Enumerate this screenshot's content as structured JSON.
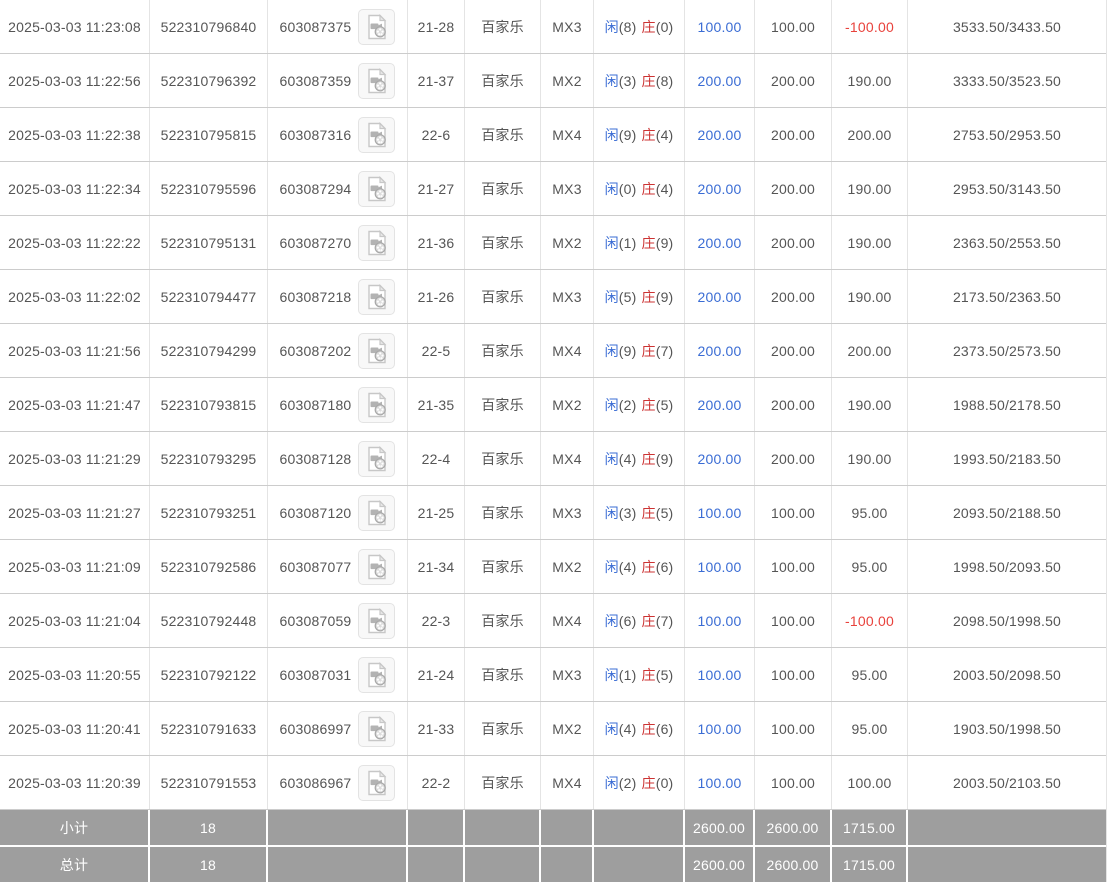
{
  "colors": {
    "text": "#555555",
    "link_blue": "#3a6cd4",
    "banker_red": "#cc3333",
    "negative_red": "#e8423c",
    "footer_bg": "#9e9e9e",
    "row_border": "#cccccc"
  },
  "table": {
    "result_labels": {
      "player": "闲",
      "banker": "庄"
    },
    "rows": [
      {
        "time": "2025-03-03 11:23:08",
        "bet_id": "522310796840",
        "game_id": "603087375",
        "round": "21-28",
        "game": "百家乐",
        "table": "MX3",
        "player": "8",
        "banker": "0",
        "bet": "100.00",
        "valid": "100.00",
        "winloss": "-100.00",
        "balance": "3533.50/3433.50"
      },
      {
        "time": "2025-03-03 11:22:56",
        "bet_id": "522310796392",
        "game_id": "603087359",
        "round": "21-37",
        "game": "百家乐",
        "table": "MX2",
        "player": "3",
        "banker": "8",
        "bet": "200.00",
        "valid": "200.00",
        "winloss": "190.00",
        "balance": "3333.50/3523.50"
      },
      {
        "time": "2025-03-03 11:22:38",
        "bet_id": "522310795815",
        "game_id": "603087316",
        "round": "22-6",
        "game": "百家乐",
        "table": "MX4",
        "player": "9",
        "banker": "4",
        "bet": "200.00",
        "valid": "200.00",
        "winloss": "200.00",
        "balance": "2753.50/2953.50"
      },
      {
        "time": "2025-03-03 11:22:34",
        "bet_id": "522310795596",
        "game_id": "603087294",
        "round": "21-27",
        "game": "百家乐",
        "table": "MX3",
        "player": "0",
        "banker": "4",
        "bet": "200.00",
        "valid": "200.00",
        "winloss": "190.00",
        "balance": "2953.50/3143.50"
      },
      {
        "time": "2025-03-03 11:22:22",
        "bet_id": "522310795131",
        "game_id": "603087270",
        "round": "21-36",
        "game": "百家乐",
        "table": "MX2",
        "player": "1",
        "banker": "9",
        "bet": "200.00",
        "valid": "200.00",
        "winloss": "190.00",
        "balance": "2363.50/2553.50"
      },
      {
        "time": "2025-03-03 11:22:02",
        "bet_id": "522310794477",
        "game_id": "603087218",
        "round": "21-26",
        "game": "百家乐",
        "table": "MX3",
        "player": "5",
        "banker": "9",
        "bet": "200.00",
        "valid": "200.00",
        "winloss": "190.00",
        "balance": "2173.50/2363.50"
      },
      {
        "time": "2025-03-03 11:21:56",
        "bet_id": "522310794299",
        "game_id": "603087202",
        "round": "22-5",
        "game": "百家乐",
        "table": "MX4",
        "player": "9",
        "banker": "7",
        "bet": "200.00",
        "valid": "200.00",
        "winloss": "200.00",
        "balance": "2373.50/2573.50"
      },
      {
        "time": "2025-03-03 11:21:47",
        "bet_id": "522310793815",
        "game_id": "603087180",
        "round": "21-35",
        "game": "百家乐",
        "table": "MX2",
        "player": "2",
        "banker": "5",
        "bet": "200.00",
        "valid": "200.00",
        "winloss": "190.00",
        "balance": "1988.50/2178.50"
      },
      {
        "time": "2025-03-03 11:21:29",
        "bet_id": "522310793295",
        "game_id": "603087128",
        "round": "22-4",
        "game": "百家乐",
        "table": "MX4",
        "player": "4",
        "banker": "9",
        "bet": "200.00",
        "valid": "200.00",
        "winloss": "190.00",
        "balance": "1993.50/2183.50"
      },
      {
        "time": "2025-03-03 11:21:27",
        "bet_id": "522310793251",
        "game_id": "603087120",
        "round": "21-25",
        "game": "百家乐",
        "table": "MX3",
        "player": "3",
        "banker": "5",
        "bet": "100.00",
        "valid": "100.00",
        "winloss": "95.00",
        "balance": "2093.50/2188.50"
      },
      {
        "time": "2025-03-03 11:21:09",
        "bet_id": "522310792586",
        "game_id": "603087077",
        "round": "21-34",
        "game": "百家乐",
        "table": "MX2",
        "player": "4",
        "banker": "6",
        "bet": "100.00",
        "valid": "100.00",
        "winloss": "95.00",
        "balance": "1998.50/2093.50"
      },
      {
        "time": "2025-03-03 11:21:04",
        "bet_id": "522310792448",
        "game_id": "603087059",
        "round": "22-3",
        "game": "百家乐",
        "table": "MX4",
        "player": "6",
        "banker": "7",
        "bet": "100.00",
        "valid": "100.00",
        "winloss": "-100.00",
        "balance": "2098.50/1998.50"
      },
      {
        "time": "2025-03-03 11:20:55",
        "bet_id": "522310792122",
        "game_id": "603087031",
        "round": "21-24",
        "game": "百家乐",
        "table": "MX3",
        "player": "1",
        "banker": "5",
        "bet": "100.00",
        "valid": "100.00",
        "winloss": "95.00",
        "balance": "2003.50/2098.50"
      },
      {
        "time": "2025-03-03 11:20:41",
        "bet_id": "522310791633",
        "game_id": "603086997",
        "round": "21-33",
        "game": "百家乐",
        "table": "MX2",
        "player": "4",
        "banker": "6",
        "bet": "100.00",
        "valid": "100.00",
        "winloss": "95.00",
        "balance": "1903.50/1998.50"
      },
      {
        "time": "2025-03-03 11:20:39",
        "bet_id": "522310791553",
        "game_id": "603086967",
        "round": "22-2",
        "game": "百家乐",
        "table": "MX4",
        "player": "2",
        "banker": "0",
        "bet": "100.00",
        "valid": "100.00",
        "winloss": "100.00",
        "balance": "2003.50/2103.50"
      }
    ],
    "footer": [
      {
        "label": "小计",
        "count": "18",
        "bet": "2600.00",
        "valid": "2600.00",
        "winloss": "1715.00"
      },
      {
        "label": "总计",
        "count": "18",
        "bet": "2600.00",
        "valid": "2600.00",
        "winloss": "1715.00"
      }
    ]
  }
}
